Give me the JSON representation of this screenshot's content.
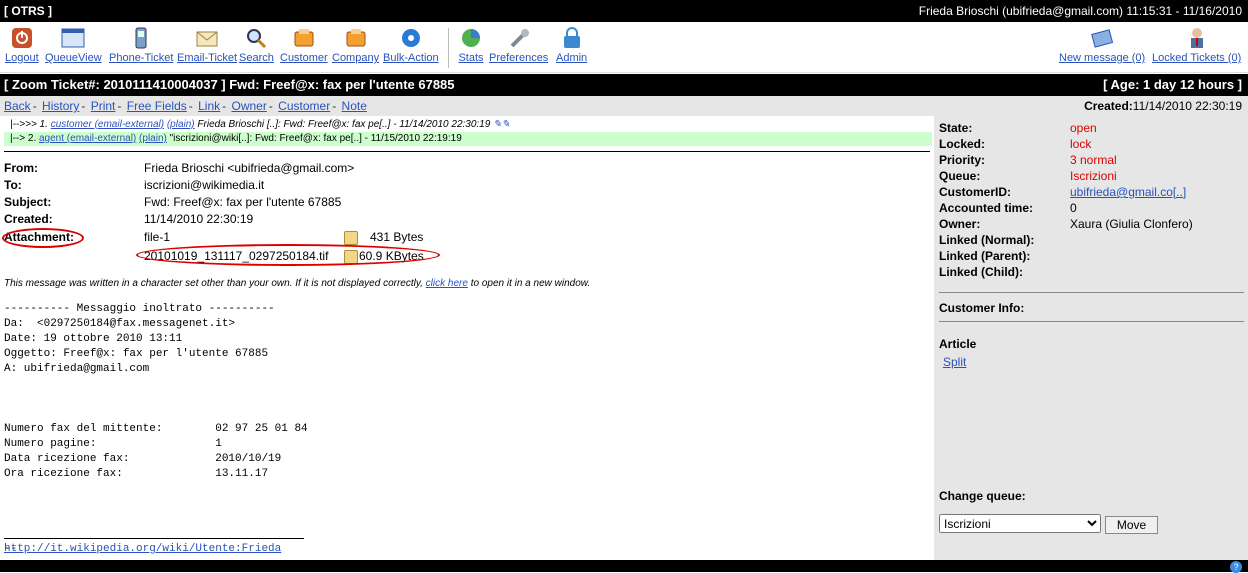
{
  "app_title": "[ OTRS ]",
  "user_info": "Frieda Brioschi (ubifrieda@gmail.com) 11:15:31 - 11/16/2010",
  "toolbar": {
    "logout": "Logout",
    "queueview": "QueueView",
    "phone_ticket": "Phone-Ticket",
    "email_ticket": "Email-Ticket",
    "search": "Search",
    "customer": "Customer",
    "company": "Company",
    "bulk_action": "Bulk-Action",
    "stats": "Stats",
    "preferences": "Preferences",
    "admin": "Admin",
    "new_message": "New message (0)",
    "locked_tickets": "Locked Tickets (0)"
  },
  "ticket_bar": {
    "title": "[ Zoom Ticket#: 2010111410004037 ] Fwd: Freef@x: fax per l'utente 67885",
    "age": "[ Age: 1 day 12 hours ]"
  },
  "nav": {
    "links": [
      "Back",
      "History",
      "Print",
      "Free Fields",
      "Link",
      "Owner",
      "Customer",
      "Note"
    ],
    "created_label": "Created:",
    "created_value": "11/14/2010 22:30:19"
  },
  "thread": {
    "row1_prefix": "|-->>> 1.",
    "row1_sender": "customer (email-external)",
    "row1_plain": "(plain)",
    "row1_text": "Frieda Brioschi [..]: Fwd: Freef@x: fax pe[..] - 11/14/2010 22:30:19",
    "row2_prefix": "|--> 2.",
    "row2_sender": "agent (email-external)",
    "row2_plain": "(plain)",
    "row2_text": "\"iscrizioni@wiki[..]: Fwd: Freef@x: fax pe[..] - 11/15/2010 22:19:19"
  },
  "headers": {
    "from_k": "From:",
    "from_v": "Frieda Brioschi <ubifrieda@gmail.com>",
    "to_k": "To:",
    "to_v": "iscrizioni@wikimedia.it",
    "subject_k": "Subject:",
    "subject_v": "Fwd: Freef@x: fax per l'utente 67885",
    "created_k": "Created:",
    "created_v": "11/14/2010 22:30:19",
    "attach_k": "Attachment:",
    "att1_name": "file-1",
    "att1_size": "431 Bytes",
    "att2_name": "20101019_131117_0297250184.tif",
    "att2_size": "60.9 KBytes"
  },
  "charset_note": {
    "before": "This message was written in a character set other than your own. If it is not displayed correctly,",
    "link": "click here",
    "after": "to open it in a new window."
  },
  "body_lines": [
    "---------- Messaggio inoltrato ----------",
    "Da:  <0297250184@fax.messagenet.it>",
    "Date: 19 ottobre 2010 13:11",
    "Oggetto: Freef@x: fax per l'utente 67885",
    "A: ubifrieda@gmail.com",
    "",
    "",
    "",
    "Numero fax del mittente:        02 97 25 01 84",
    "Numero pagine:                  1",
    "Data ricezione fax:             2010/10/19",
    "Ora ricezione fax:              13.11.17",
    "",
    "",
    "",
    "",
    "--"
  ],
  "signature_link": "http://it.wikipedia.org/wiki/Utente:Frieda",
  "side": {
    "state_k": "State:",
    "state_v": "open",
    "locked_k": "Locked:",
    "locked_v": "lock",
    "priority_k": "Priority:",
    "priority_v": "3 normal",
    "queue_k": "Queue:",
    "queue_v": "Iscrizioni",
    "customerid_k": "CustomerID:",
    "customerid_v": "ubifrieda@gmail.co[..]",
    "accounted_k": "Accounted time:",
    "accounted_v": "0",
    "owner_k": "Owner:",
    "owner_v": "Xaura (Giulia Clonfero)",
    "linked_normal": "Linked (Normal):",
    "linked_parent": "Linked (Parent):",
    "linked_child": "Linked (Child):",
    "customer_info": "Customer Info:",
    "article": "Article",
    "split": "Split",
    "change_queue": "Change queue:",
    "queue_select": "Iscrizioni",
    "move": "Move"
  },
  "colors": {
    "link": "#2a52be",
    "status_red": "#dd0000",
    "thread_green": "#ccffcc"
  }
}
